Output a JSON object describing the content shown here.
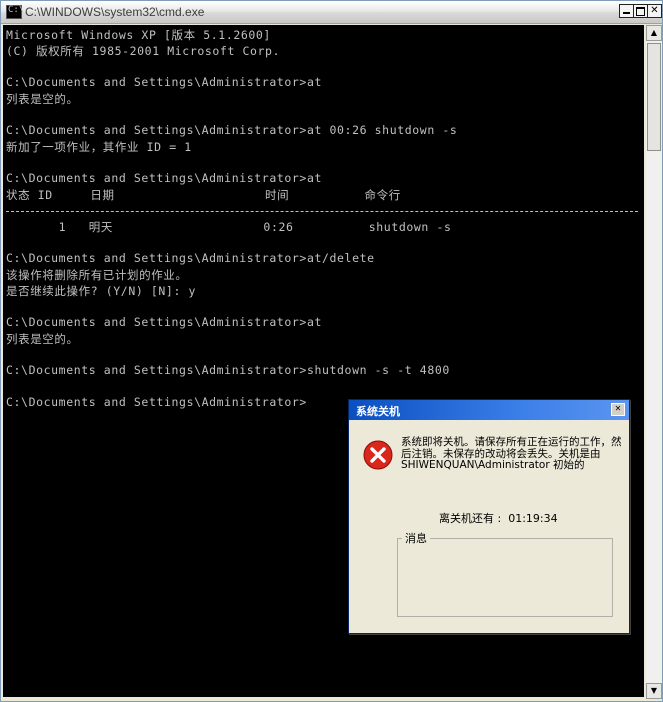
{
  "window": {
    "title": "C:\\WINDOWS\\system32\\cmd.exe",
    "icon_text": "C:\\",
    "buttons": [
      "minimize",
      "maximize",
      "close"
    ],
    "close_glyph": "✕"
  },
  "console": {
    "lines": [
      "Microsoft Windows XP [版本 5.1.2600]",
      "(C) 版权所有 1985-2001 Microsoft Corp.",
      "",
      "C:\\Documents and Settings\\Administrator>at",
      "列表是空的。",
      "",
      "C:\\Documents and Settings\\Administrator>at 00:26 shutdown -s",
      "新加了一项作业，其作业 ID = 1",
      "",
      "C:\\Documents and Settings\\Administrator>at",
      "状态 ID     日期                    时间          命令行",
      "",
      "       1   明天                    0:26          shutdown -s",
      "",
      "C:\\Documents and Settings\\Administrator>at/delete",
      "该操作将删除所有已计划的作业。",
      "是否继续此操作? (Y/N) [N]: y",
      "",
      "C:\\Documents and Settings\\Administrator>at",
      "列表是空的。",
      "",
      "C:\\Documents and Settings\\Administrator>shutdown -s -t 4800",
      "",
      "C:\\Documents and Settings\\Administrator>"
    ]
  },
  "dialog": {
    "title": "系统关机",
    "close_glyph": "✕",
    "message": "系统即将关机。请保存所有正在运行的工作，然后注销。未保存的改动将会丢失。关机是由 SHIWENQUAN\\Administrator 初始的",
    "countdown_label": "离关机还有 :",
    "countdown_value": "01:19:34",
    "message_group_label": "消息"
  }
}
